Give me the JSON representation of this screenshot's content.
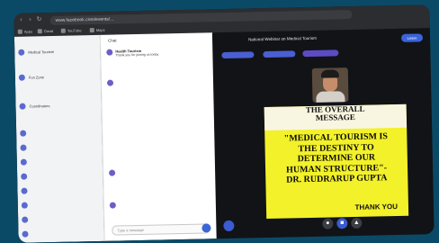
{
  "browser": {
    "url": "www.facebook.com/events/...",
    "bookmarks": [
      "Apps",
      "Gmail",
      "YouTube",
      "Maps"
    ]
  },
  "sidebar": {
    "channels": [
      "Medical Tourism",
      "Fun Zone",
      "Coordinators",
      "",
      "",
      "",
      "",
      "",
      "",
      "",
      "",
      ""
    ]
  },
  "chat": {
    "header": "Chat",
    "messages": [
      {
        "name": "Health Tourism",
        "body": "Thank you for joining us today"
      },
      {
        "name": "",
        "body": ""
      },
      {
        "name": "",
        "body": ""
      },
      {
        "name": "",
        "body": ""
      }
    ],
    "composer_placeholder": "Type a message"
  },
  "stage": {
    "title": "National Webinar on Medical Tourism",
    "leave_label": "Leave",
    "tabs": [
      "",
      "",
      ""
    ]
  },
  "slide": {
    "heading": [
      "THE OVERALL",
      "MESSAGE"
    ],
    "quote": [
      "\"MEDICAL TOURISM IS",
      "THE DESTINY TO",
      "DETERMINE OUR",
      "HUMAN STRUCTURE\"-",
      "DR. RUDRARUP GUPTA"
    ],
    "footer": "THANK YOU"
  },
  "colors": {
    "accent": "#3b66d8",
    "slide_bg": "#f3f12a",
    "stage_bg": "#111317"
  }
}
